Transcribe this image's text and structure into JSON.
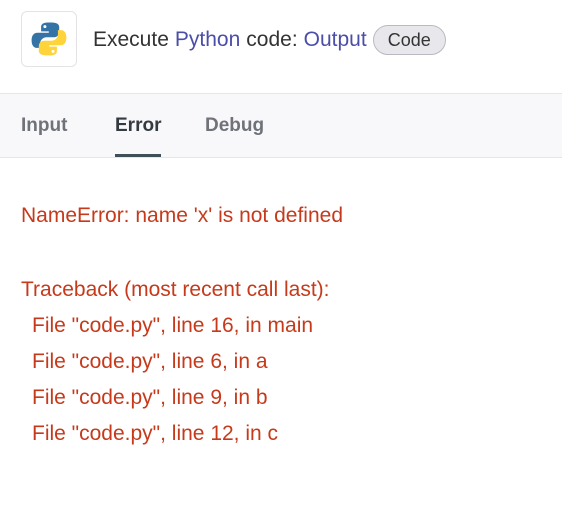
{
  "header": {
    "icon": "python-logo",
    "title_prefix": "Execute",
    "title_language": "Python",
    "title_middle": "code:",
    "title_output": "Output",
    "badge_label": "Code"
  },
  "tabs": [
    {
      "label": "Input",
      "active": false
    },
    {
      "label": "Error",
      "active": true
    },
    {
      "label": "Debug",
      "active": false
    }
  ],
  "error": {
    "message": "NameError: name 'x' is not defined",
    "traceback_header": "Traceback (most recent call last):",
    "frames": [
      "File \"code.py\", line 16, in main",
      "File \"code.py\", line 6, in a",
      "File \"code.py\", line 9, in b",
      "File \"code.py\", line 12, in c"
    ]
  },
  "colors": {
    "accent": "#4b4ea8",
    "error_text": "#c63a1b",
    "python_blue": "#3572a5",
    "python_yellow": "#ffd43b"
  }
}
